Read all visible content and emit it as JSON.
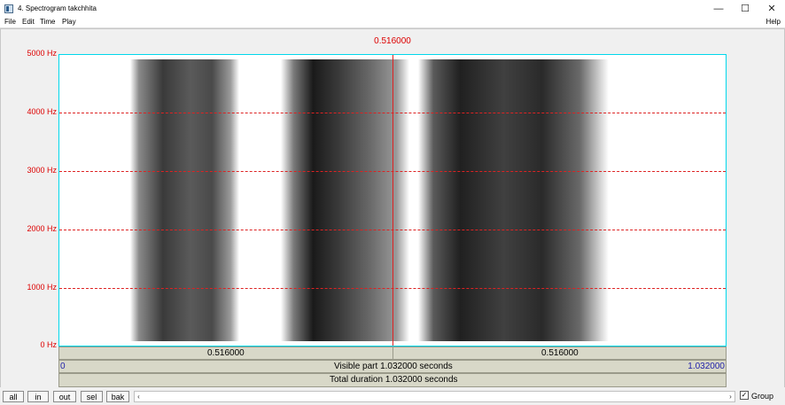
{
  "window": {
    "title": "4. Spectrogram takchhita",
    "controls": {
      "minimize": "—",
      "maximize": "☐",
      "close": "✕"
    },
    "icon": "praat-window-icon"
  },
  "menu": {
    "file": "File",
    "edit": "Edit",
    "time": "Time",
    "play": "Play",
    "help": "Help"
  },
  "spectrogram": {
    "cursor_time": "0.516000",
    "y_axis": {
      "unit": "Hz",
      "ticks": [
        {
          "label": "5000 Hz",
          "value": 5000
        },
        {
          "label": "4000 Hz",
          "value": 4000
        },
        {
          "label": "3000 Hz",
          "value": 3000
        },
        {
          "label": "2000 Hz",
          "value": 2000
        },
        {
          "label": "1000 Hz",
          "value": 1000
        },
        {
          "label": "0 Hz",
          "value": 0
        }
      ],
      "range": [
        0,
        5000
      ]
    },
    "x_range": [
      0,
      1.032
    ],
    "colors": {
      "grid": "#dd2222",
      "border": "#00d8ec",
      "label": "#dd0000"
    }
  },
  "time_bars": {
    "left_segment": "0.516000",
    "right_segment": "0.516000",
    "visible_start": "0",
    "visible_label": "Visible part 1.032000 seconds",
    "visible_end": "1.032000",
    "total_label": "Total duration 1.032000 seconds"
  },
  "bottom": {
    "buttons": [
      "all",
      "in",
      "out",
      "sel",
      "bak"
    ],
    "scroll_left": "‹",
    "scroll_right": "›",
    "group_checked": "✓",
    "group_label": "Group"
  }
}
